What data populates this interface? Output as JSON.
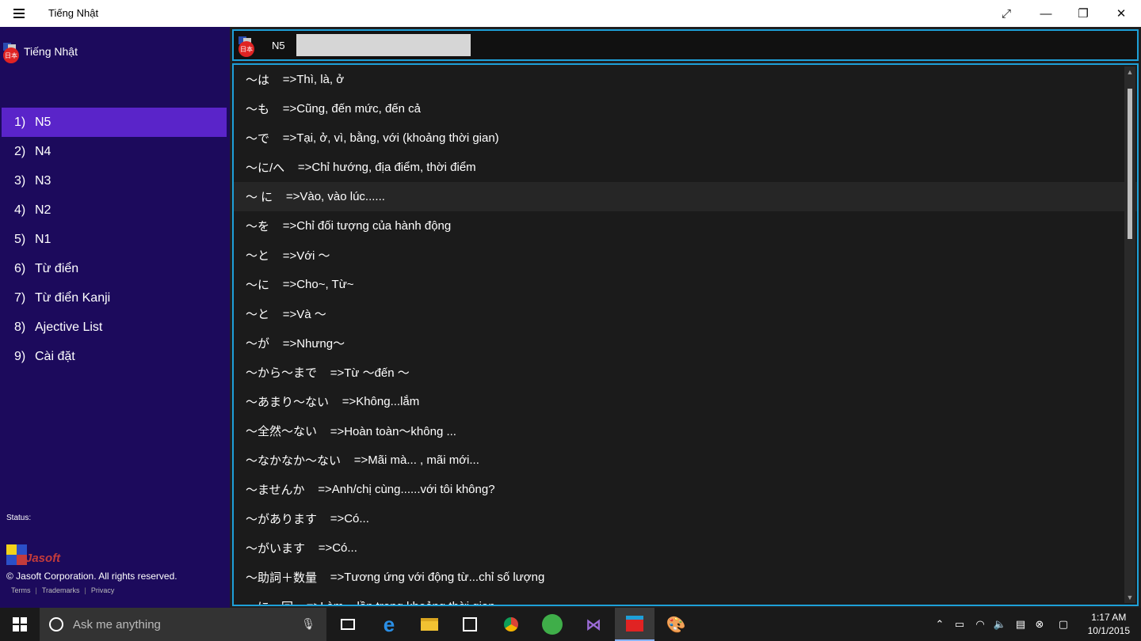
{
  "window": {
    "title": "Tiếng Nhật"
  },
  "app": {
    "name": "Tiếng Nhật",
    "flag_text": "日本"
  },
  "nav": [
    {
      "num": "1)",
      "label": "N5"
    },
    {
      "num": "2)",
      "label": "N4"
    },
    {
      "num": "3)",
      "label": "N3"
    },
    {
      "num": "4)",
      "label": "N2"
    },
    {
      "num": "5)",
      "label": "N1"
    },
    {
      "num": "6)",
      "label": "Từ điển"
    },
    {
      "num": "7)",
      "label": "Từ điển Kanji"
    },
    {
      "num": "8)",
      "label": "Ajective List"
    },
    {
      "num": "9)",
      "label": "Cài đặt"
    }
  ],
  "status_label": "Status:",
  "brand": "Jasoft",
  "copyright": "© Jasoft Corporation. All rights reserved.",
  "links": [
    "Terms",
    "Trademarks",
    "Privacy"
  ],
  "header": {
    "level": "N5",
    "search_value": ""
  },
  "grammar": [
    {
      "jp": "〜は",
      "vi": "=>Thì, là, ở"
    },
    {
      "jp": "〜も",
      "vi": "=>Cũng, đến mức, đến cả"
    },
    {
      "jp": "〜で",
      "vi": "=>Tại, ở, vì, bằng, với (khoảng thời gian)"
    },
    {
      "jp": "〜に/へ",
      "vi": "=>Chỉ hướng, địa điểm, thời điểm"
    },
    {
      "jp": "〜 に",
      "vi": "=>Vào, vào lúc......"
    },
    {
      "jp": "〜を",
      "vi": "=>Chỉ đối tượng của hành động"
    },
    {
      "jp": "〜と",
      "vi": "=>Với 〜"
    },
    {
      "jp": "〜に",
      "vi": "=>Cho~, Từ~"
    },
    {
      "jp": "〜と",
      "vi": "=>Và 〜"
    },
    {
      "jp": "〜が",
      "vi": "=>Nhưng〜"
    },
    {
      "jp": "〜から〜まで",
      "vi": "=>Từ 〜đến 〜"
    },
    {
      "jp": "〜あまり〜ない",
      "vi": "=>Không...lắm"
    },
    {
      "jp": "〜全然〜ない",
      "vi": "=>Hoàn toàn〜không ..."
    },
    {
      "jp": "〜なかなか〜ない",
      "vi": "=>Mãi mà... , mãi mới..."
    },
    {
      "jp": "〜ませんか",
      "vi": "=>Anh/chị cùng......với tôi không?"
    },
    {
      "jp": "〜があります",
      "vi": "=>Có..."
    },
    {
      "jp": "〜がいます",
      "vi": "=>Có..."
    },
    {
      "jp": "〜助詞＋数量",
      "vi": "=>Tương ứng với động từ...chỉ số lượng"
    },
    {
      "jp": "〜に〜回",
      "vi": "=>Làm ~ lần trong khoảng thời gian ~"
    }
  ],
  "taskbar": {
    "search_placeholder": "Ask me anything",
    "time": "1:17 AM",
    "date": "10/1/2015"
  },
  "colors": {
    "sidebar_bg": "#1c0a5c",
    "nav_active": "#5a24c9",
    "accent_border": "#1ea0d8"
  }
}
